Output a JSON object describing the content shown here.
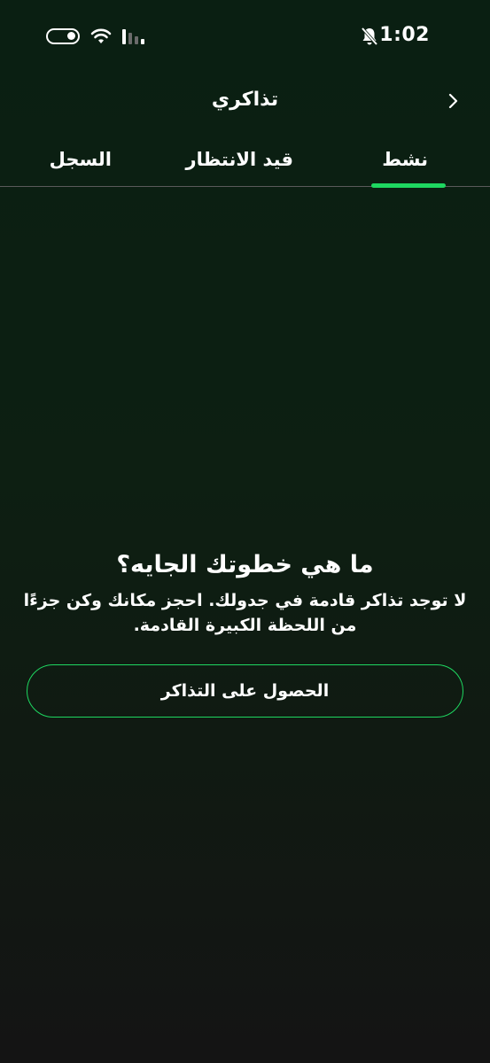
{
  "status_bar": {
    "time": "1:02"
  },
  "header": {
    "title": "تذاكري"
  },
  "tabs": [
    {
      "label": "نشط",
      "active": true
    },
    {
      "label": "قيد الانتظار",
      "active": false
    },
    {
      "label": "السجل",
      "active": false
    }
  ],
  "empty_state": {
    "heading": "ما هي خطوتك الجايه؟",
    "body": "لا توجد تذاكر قادمة في جدولك. احجز مكانك وكن جزءًا من اللحظة الكبيرة القادمة.",
    "button_label": "الحصول على التذاكر"
  },
  "colors": {
    "accent": "#1ed760",
    "background_top": "#0a1f12",
    "background_bottom": "#141414",
    "text": "#ffffff"
  },
  "icons": {
    "back": "chevron-right-icon",
    "bell_muted": "bell-off-icon",
    "wifi": "wifi-icon",
    "signal": "signal-icon",
    "toggle": "toggle-icon"
  }
}
